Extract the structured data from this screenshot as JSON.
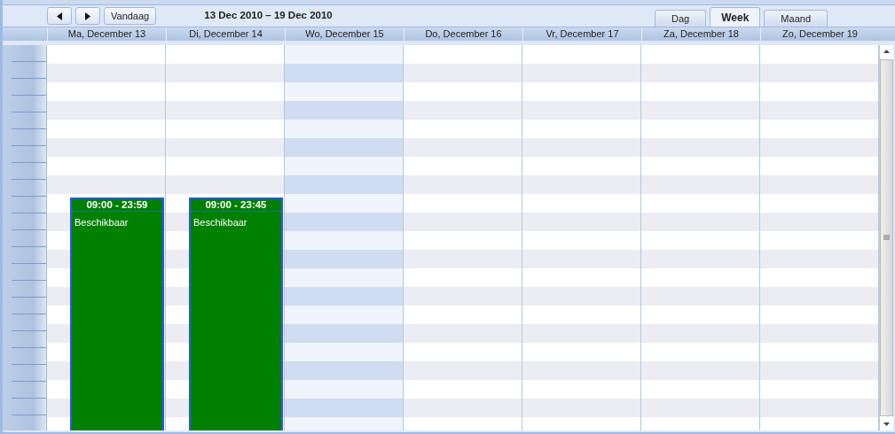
{
  "toolbar": {
    "today_button": "Vandaag",
    "date_range": "13 Dec 2010 – 19 Dec 2010"
  },
  "view_tabs": [
    {
      "label": "Dag",
      "selected": false
    },
    {
      "label": "Week",
      "selected": true
    },
    {
      "label": "Maand",
      "selected": false
    }
  ],
  "days": [
    {
      "header": "Ma, December 13",
      "highlighted": false,
      "events": [
        {
          "time": "09:00 - 23:59",
          "title": "Beschikbaar"
        }
      ]
    },
    {
      "header": "Di, December 14",
      "highlighted": false,
      "events": [
        {
          "time": "09:00 - 23:45",
          "title": "Beschikbaar"
        }
      ]
    },
    {
      "header": "Wo, December 15",
      "highlighted": true
    },
    {
      "header": "Do, December 16",
      "highlighted": false
    },
    {
      "header": "Vr, December 17",
      "highlighted": false
    },
    {
      "header": "Za, December 18",
      "highlighted": false
    },
    {
      "header": "Zo, December 19",
      "highlighted": false
    }
  ]
}
